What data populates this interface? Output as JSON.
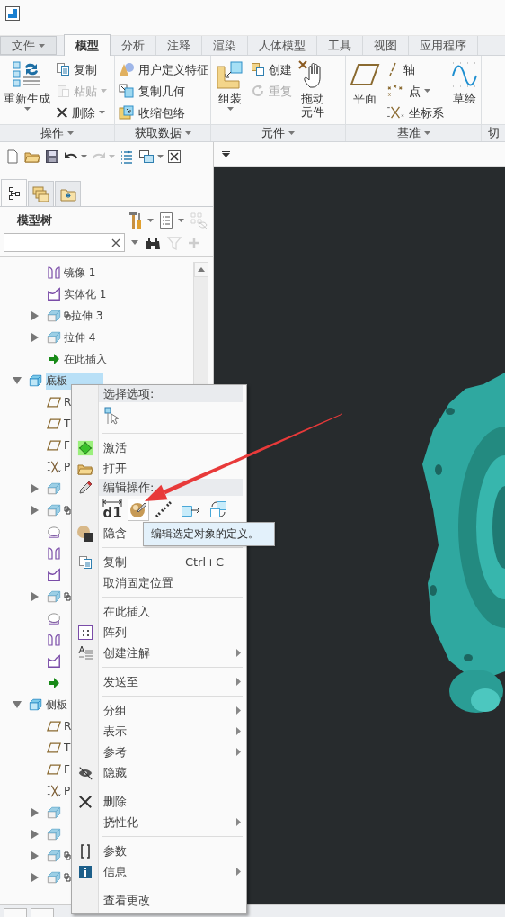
{
  "ribbon": {
    "tabs": [
      {
        "kind": "menu",
        "label": "文件",
        "selected": false
      },
      {
        "kind": "tab",
        "label": "模型",
        "selected": true
      },
      {
        "kind": "tab",
        "label": "分析",
        "selected": false
      },
      {
        "kind": "tab",
        "label": "注释",
        "selected": false
      },
      {
        "kind": "tab",
        "label": "渲染",
        "selected": false
      },
      {
        "kind": "tab",
        "label": "人体模型",
        "selected": false
      },
      {
        "kind": "tab",
        "label": "工具",
        "selected": false
      },
      {
        "kind": "tab",
        "label": "视图",
        "selected": false
      },
      {
        "kind": "tab",
        "label": "应用程序",
        "selected": false
      }
    ],
    "groups": [
      {
        "label": "操作",
        "dropdown": true,
        "columns": [
          [
            {
              "kind": "large",
              "label": "重新生成",
              "dropdown": true,
              "disabled": false
            }
          ],
          [
            {
              "kind": "small",
              "label": "复制",
              "disabled": false
            },
            {
              "kind": "small",
              "label": "粘贴",
              "dropdown": true,
              "disabled": true
            },
            {
              "kind": "small",
              "label": "删除",
              "dropdown": true,
              "disabled": false
            }
          ]
        ]
      },
      {
        "label": "获取数据",
        "dropdown": true,
        "columns": [
          [
            {
              "kind": "small",
              "label": "用户定义特征",
              "disabled": false
            },
            {
              "kind": "small",
              "label": "复制几何",
              "disabled": false
            },
            {
              "kind": "small",
              "label": "收缩包络",
              "disabled": false
            }
          ]
        ]
      },
      {
        "label": "元件",
        "dropdown": true,
        "columns": [
          [
            {
              "kind": "large",
              "label": "组装",
              "dropdown": true,
              "disabled": false
            }
          ],
          [
            {
              "kind": "small",
              "label": "创建",
              "disabled": false
            },
            {
              "kind": "small",
              "label": "重复",
              "disabled": true
            }
          ],
          [
            {
              "kind": "large",
              "label": "拖动元件",
              "disabled": false
            }
          ]
        ]
      },
      {
        "label": "基准",
        "dropdown": true,
        "columns": [
          [
            {
              "kind": "large",
              "label": "平面",
              "disabled": false
            }
          ],
          [
            {
              "kind": "small",
              "label": "轴",
              "disabled": false
            },
            {
              "kind": "small",
              "label": "点",
              "dropdown": true,
              "disabled": false
            },
            {
              "kind": "small",
              "label": "坐标系",
              "disabled": false
            }
          ],
          [
            {
              "kind": "large",
              "label": "草绘",
              "disabled": false
            }
          ]
        ]
      },
      {
        "label": "切"
      }
    ]
  },
  "quick_access": [
    {
      "disabled": false
    },
    {
      "disabled": false
    },
    {
      "disabled": false
    },
    {
      "disabled": false,
      "dropdown": true
    },
    {
      "disabled": true,
      "dropdown": true
    },
    {
      "disabled": false
    },
    {
      "disabled": false,
      "dropdown": true
    },
    {
      "disabled": false
    }
  ],
  "navigator_tabs": [
    {
      "selected": true
    },
    {
      "selected": false
    },
    {
      "selected": false
    }
  ],
  "model_tree": {
    "title": "模型树",
    "tools": [
      {
        "dropdown": true,
        "disabled": false
      },
      {
        "dropdown": true,
        "disabled": false
      },
      {
        "disabled": true
      }
    ],
    "search_tools": [
      {
        "disabled": false
      },
      {
        "disabled": true
      },
      {
        "disabled": true
      }
    ],
    "continued_items": [
      {
        "kind": "mirror",
        "label": "镜像 1",
        "selected": false
      },
      {
        "kind": "solidify",
        "label": "实体化 1",
        "selected": false
      },
      {
        "kind": "extrude",
        "label": "拉伸 3",
        "expanded": false,
        "marker": true,
        "selected": false
      },
      {
        "kind": "extrude",
        "label": "拉伸 4",
        "expanded": false,
        "selected": false
      },
      {
        "kind": "insert",
        "label": "在此插入",
        "selected": false
      }
    ],
    "items": [
      {
        "kind": "part",
        "label": "底板",
        "expanded": true,
        "selected": true,
        "children": [
          {
            "kind": "plane",
            "label": "R",
            "selected": false
          },
          {
            "kind": "plane",
            "label": "T",
            "selected": false
          },
          {
            "kind": "plane",
            "label": "F",
            "selected": false
          },
          {
            "kind": "csys",
            "label": "P",
            "selected": false
          },
          {
            "kind": "extrude",
            "expanded": false
          },
          {
            "kind": "extrude",
            "expanded": false,
            "marker": true
          },
          {
            "kind": "copy"
          },
          {
            "kind": "mirror"
          },
          {
            "kind": "solidify"
          },
          {
            "kind": "extrude",
            "expanded": false,
            "marker": true
          },
          {
            "kind": "copy"
          },
          {
            "kind": "mirror"
          },
          {
            "kind": "solidify"
          },
          {
            "kind": "insert"
          }
        ]
      },
      {
        "kind": "part",
        "label": "侧板",
        "expanded": true,
        "selected": false,
        "children": [
          {
            "kind": "plane",
            "label": "R",
            "selected": false
          },
          {
            "kind": "plane",
            "label": "T",
            "selected": false
          },
          {
            "kind": "plane",
            "label": "F",
            "selected": false
          },
          {
            "kind": "csys",
            "label": "P",
            "selected": false
          },
          {
            "kind": "extrude",
            "expanded": false
          },
          {
            "kind": "extrude",
            "expanded": false
          },
          {
            "kind": "extrude",
            "expanded": false,
            "marker": true
          },
          {
            "kind": "extrude",
            "expanded": false,
            "marker": true
          }
        ]
      }
    ]
  },
  "context_menu": {
    "entries": [
      {
        "kind": "header",
        "label": "选择选项:"
      },
      {
        "kind": "icon_row",
        "buttons": [
          {
            "hovered": false
          }
        ]
      },
      {
        "kind": "separator"
      },
      {
        "kind": "item",
        "label": "激活"
      },
      {
        "kind": "item",
        "label": "打开"
      },
      {
        "kind": "header",
        "label": "编辑操作:"
      },
      {
        "kind": "icon_row",
        "buttons": [
          {
            "label": "d1",
            "hovered": false
          },
          {
            "hovered": true
          },
          {
            "hovered": false
          },
          {
            "hovered": false
          },
          {
            "hovered": false
          }
        ]
      },
      {
        "kind": "item",
        "label": "隐含"
      },
      {
        "kind": "separator"
      },
      {
        "kind": "item",
        "label": "复制",
        "shortcut": "Ctrl+C"
      },
      {
        "kind": "item",
        "label": "取消固定位置"
      },
      {
        "kind": "separator"
      },
      {
        "kind": "item",
        "label": "在此插入"
      },
      {
        "kind": "item",
        "label": "阵列"
      },
      {
        "kind": "item",
        "label": "创建注解",
        "submenu": true
      },
      {
        "kind": "separator"
      },
      {
        "kind": "item",
        "label": "发送至",
        "submenu": true
      },
      {
        "kind": "separator"
      },
      {
        "kind": "item",
        "label": "分组",
        "submenu": true
      },
      {
        "kind": "item",
        "label": "表示",
        "submenu": true
      },
      {
        "kind": "item",
        "label": "参考",
        "submenu": true
      },
      {
        "kind": "item",
        "label": "隐藏"
      },
      {
        "kind": "separator"
      },
      {
        "kind": "item",
        "label": "删除"
      },
      {
        "kind": "item",
        "label": "挠性化",
        "submenu": true
      },
      {
        "kind": "separator"
      },
      {
        "kind": "item",
        "label": "参数"
      },
      {
        "kind": "item",
        "label": "信息",
        "submenu": true
      },
      {
        "kind": "separator"
      },
      {
        "kind": "item",
        "label": "查看更改"
      }
    ]
  },
  "tooltip": {
    "text": "编辑选定对象的定义。"
  }
}
